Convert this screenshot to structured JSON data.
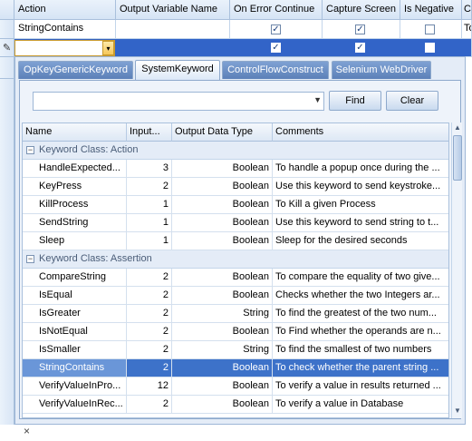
{
  "outer_grid": {
    "columns": [
      "Action",
      "Output Variable Name",
      "On Error Continue",
      "Capture Screen",
      "Is Negative",
      "Co"
    ],
    "row1": {
      "action": "StringContains",
      "on_error": true,
      "capture": true,
      "negative": false,
      "extra": "To"
    },
    "row2": {
      "on_error": true,
      "capture": true,
      "negative": false
    }
  },
  "popup": {
    "tabs": [
      "OpKeyGenericKeyword",
      "SystemKeyword",
      "ControlFlowConstruct",
      "Selenium WebDriver"
    ],
    "active_tab": "SystemKeyword",
    "search_value": "",
    "find_label": "Find",
    "clear_label": "Clear",
    "grid": {
      "columns": [
        "Name",
        "Input...",
        "Output Data Type",
        "Comments"
      ],
      "groups": [
        {
          "label": "Keyword Class: Action",
          "rows": [
            {
              "name": "HandleExpected...",
              "inputs": "3",
              "type": "Boolean",
              "comment": "To handle a popup once during the ..."
            },
            {
              "name": "KeyPress",
              "inputs": "2",
              "type": "Boolean",
              "comment": "Use this keyword to send keystroke..."
            },
            {
              "name": "KillProcess",
              "inputs": "1",
              "type": "Boolean",
              "comment": "To Kill a given Process"
            },
            {
              "name": "SendString",
              "inputs": "1",
              "type": "Boolean",
              "comment": "Use this keyword to send string to t..."
            },
            {
              "name": "Sleep",
              "inputs": "1",
              "type": "Boolean",
              "comment": "Sleep for the desired seconds"
            }
          ]
        },
        {
          "label": "Keyword Class: Assertion",
          "rows": [
            {
              "name": "CompareString",
              "inputs": "2",
              "type": "Boolean",
              "comment": "To compare the equality of two give..."
            },
            {
              "name": "IsEqual",
              "inputs": "2",
              "type": "Boolean",
              "comment": "Checks whether the two Integers ar..."
            },
            {
              "name": "IsGreater",
              "inputs": "2",
              "type": "String",
              "comment": "To find the greatest of the two num..."
            },
            {
              "name": "IsNotEqual",
              "inputs": "2",
              "type": "Boolean",
              "comment": "To Find whether the operands are n..."
            },
            {
              "name": "IsSmaller",
              "inputs": "2",
              "type": "String",
              "comment": "To find the smallest of two numbers"
            },
            {
              "name": "StringContains",
              "inputs": "2",
              "type": "Boolean",
              "comment": "To check whether the parent string ...",
              "selected": true
            },
            {
              "name": "VerifyValueInPro...",
              "inputs": "12",
              "type": "Boolean",
              "comment": "To verify a value in results returned ..."
            },
            {
              "name": "VerifyValueInRec...",
              "inputs": "2",
              "type": "Boolean",
              "comment": "To verify a value in Database"
            }
          ]
        }
      ]
    }
  },
  "close_glyph": "×"
}
